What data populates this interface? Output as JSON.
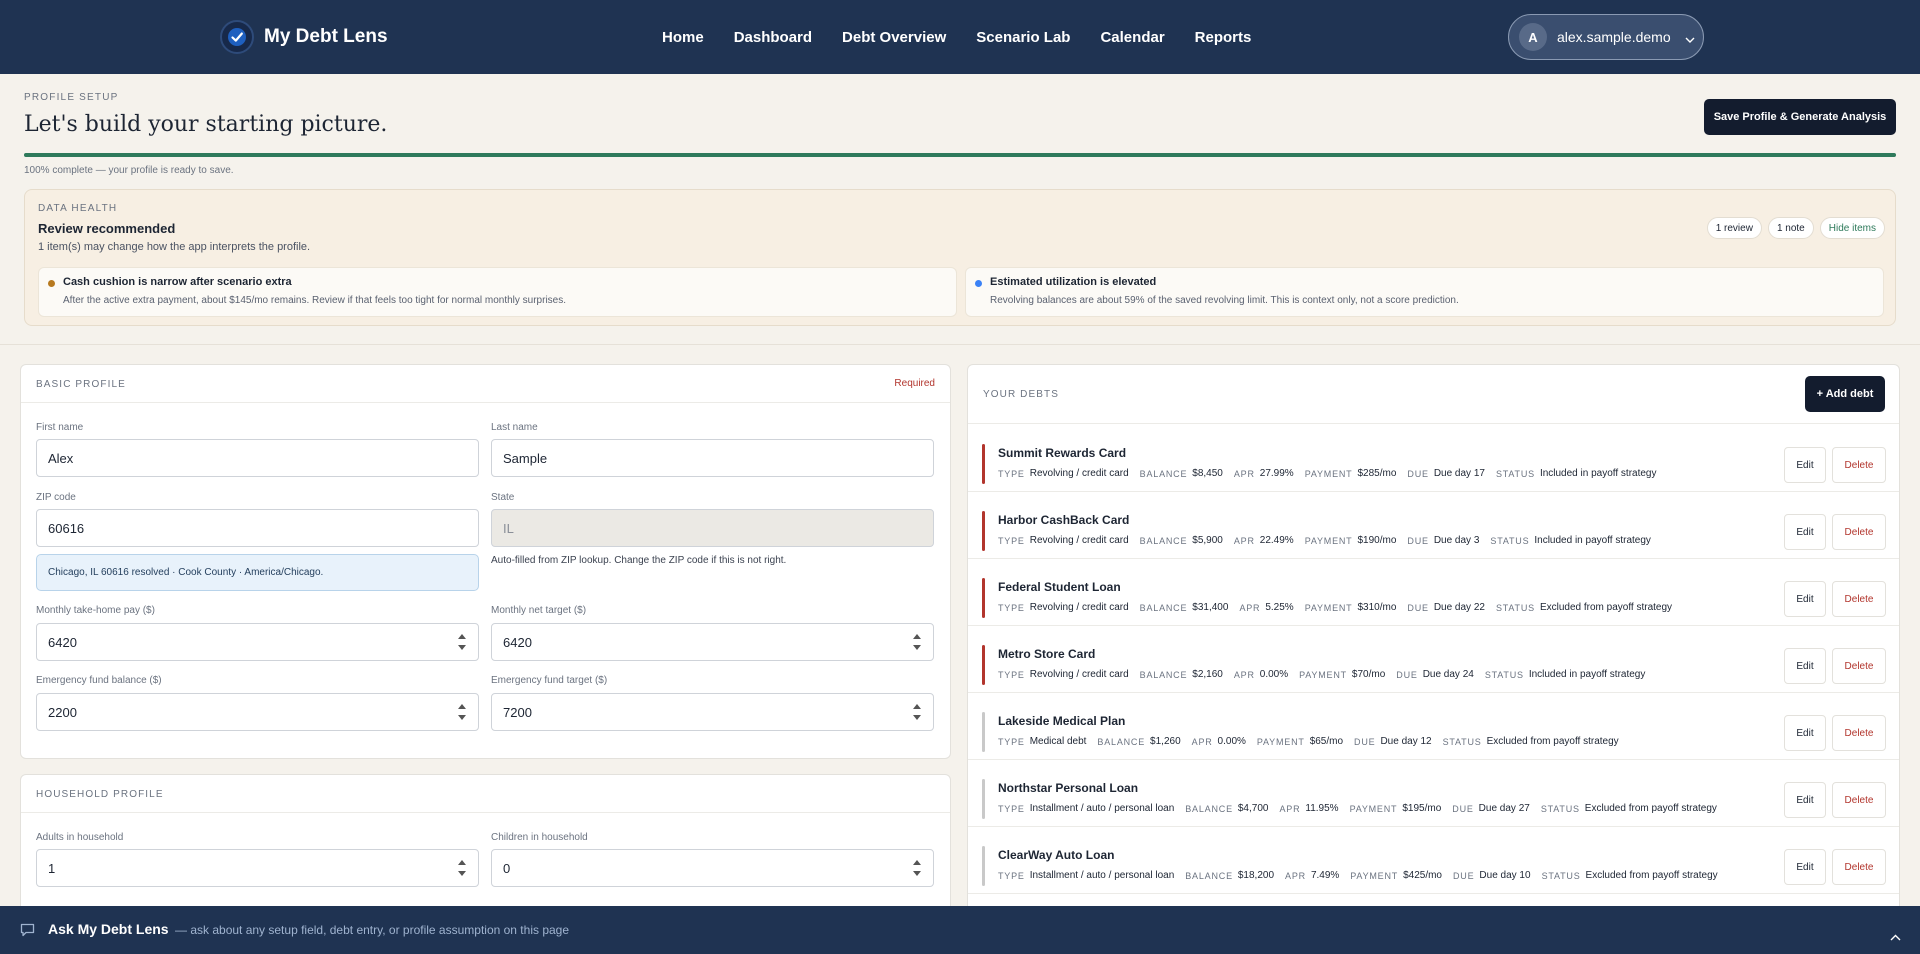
{
  "app": {
    "title": "My Debt Lens"
  },
  "nav": {
    "links": [
      {
        "label": "Home"
      },
      {
        "label": "Dashboard"
      },
      {
        "label": "Debt Overview"
      },
      {
        "label": "Scenario Lab"
      },
      {
        "label": "Calendar"
      },
      {
        "label": "Reports"
      }
    ],
    "user": {
      "initial": "A",
      "name": "alex.sample.demo"
    }
  },
  "header": {
    "eyebrow": "PROFILE SETUP",
    "title": "Let's build your starting picture.",
    "save_label": "Save Profile & Generate Analysis",
    "progress": {
      "fraction": 1.0,
      "text": "100% complete — your profile is ready to save."
    }
  },
  "health": {
    "eyebrow": "DATA HEALTH",
    "title": "Review recommended",
    "subtitle": "1 item(s) may change how the app interprets the profile.",
    "pills": {
      "review": "1 review",
      "note": "1 note",
      "hide": "Hide items"
    },
    "items": [
      {
        "title": "Cash cushion is narrow after scenario extra",
        "text": "After the active extra payment, about $145/mo remains. Review if that feels too tight for normal monthly surprises.",
        "color": "#b7791f"
      },
      {
        "title": "Estimated utilization is elevated",
        "text": "Revolving balances are about 59% of the saved revolving limit. This is context only, not a score prediction.",
        "color": "#3b82f6"
      }
    ]
  },
  "basic": {
    "label": "BASIC PROFILE",
    "required": "Required",
    "first_name": {
      "label": "First name",
      "value": "Alex"
    },
    "last_name": {
      "label": "Last name",
      "value": "Sample"
    },
    "zip": {
      "label": "ZIP code",
      "value": "60616",
      "resolved": "Chicago, IL 60616 resolved · Cook County · America/Chicago."
    },
    "state": {
      "label": "State",
      "value": "IL",
      "hint": "Auto-filled from ZIP lookup. Change the ZIP code if this is not right."
    },
    "take_home": {
      "label": "Monthly take-home pay ($)",
      "value": "6420"
    },
    "net_target": {
      "label": "Monthly net target ($)",
      "value": "6420"
    },
    "ef_balance": {
      "label": "Emergency fund balance ($)",
      "value": "2200"
    },
    "ef_target": {
      "label": "Emergency fund target ($)",
      "value": "7200"
    }
  },
  "household": {
    "label": "HOUSEHOLD PROFILE",
    "adults": {
      "label": "Adults in household",
      "value": "1"
    },
    "children": {
      "label": "Children in household",
      "value": "0"
    }
  },
  "debts": {
    "label": "YOUR DEBTS",
    "add_label": "+ Add debt",
    "keys": {
      "type": "TYPE",
      "balance": "BALANCE",
      "apr": "APR",
      "payment": "PAYMENT",
      "due": "DUE",
      "status": "STATUS"
    },
    "edit_label": "Edit",
    "delete_label": "Delete",
    "items": [
      {
        "name": "Summit Rewards Card",
        "type": "Revolving / credit card",
        "balance": "$8,450",
        "apr": "27.99%",
        "payment": "$285/mo",
        "due": "Due day 17",
        "status": "Included in payoff strategy",
        "color": "#b2352d"
      },
      {
        "name": "Harbor CashBack Card",
        "type": "Revolving / credit card",
        "balance": "$5,900",
        "apr": "22.49%",
        "payment": "$190/mo",
        "due": "Due day 3",
        "status": "Included in payoff strategy",
        "color": "#b2352d"
      },
      {
        "name": "Federal Student Loan",
        "type": "Revolving / credit card",
        "balance": "$31,400",
        "apr": "5.25%",
        "payment": "$310/mo",
        "due": "Due day 22",
        "status": "Excluded from payoff strategy",
        "color": "#b2352d"
      },
      {
        "name": "Metro Store Card",
        "type": "Revolving / credit card",
        "balance": "$2,160",
        "apr": "0.00%",
        "payment": "$70/mo",
        "due": "Due day 24",
        "status": "Included in payoff strategy",
        "color": "#b2352d"
      },
      {
        "name": "Lakeside Medical Plan",
        "type": "Medical debt",
        "balance": "$1,260",
        "apr": "0.00%",
        "payment": "$65/mo",
        "due": "Due day 12",
        "status": "Excluded from payoff strategy",
        "color": "#c9c9c9"
      },
      {
        "name": "Northstar Personal Loan",
        "type": "Installment / auto / personal loan",
        "balance": "$4,700",
        "apr": "11.95%",
        "payment": "$195/mo",
        "due": "Due day 27",
        "status": "Excluded from payoff strategy",
        "color": "#c9c9c9"
      },
      {
        "name": "ClearWay Auto Loan",
        "type": "Installment / auto / personal loan",
        "balance": "$18,200",
        "apr": "7.49%",
        "payment": "$425/mo",
        "due": "Due day 10",
        "status": "Excluded from payoff strategy",
        "color": "#c9c9c9"
      }
    ]
  },
  "assistant": {
    "title": "Ask My Debt Lens",
    "subtitle": "— ask about any setup field, debt entry, or profile assumption on this page",
    "icons": {
      "chat": "chat-icon",
      "expand": "chevron-up-icon"
    }
  }
}
